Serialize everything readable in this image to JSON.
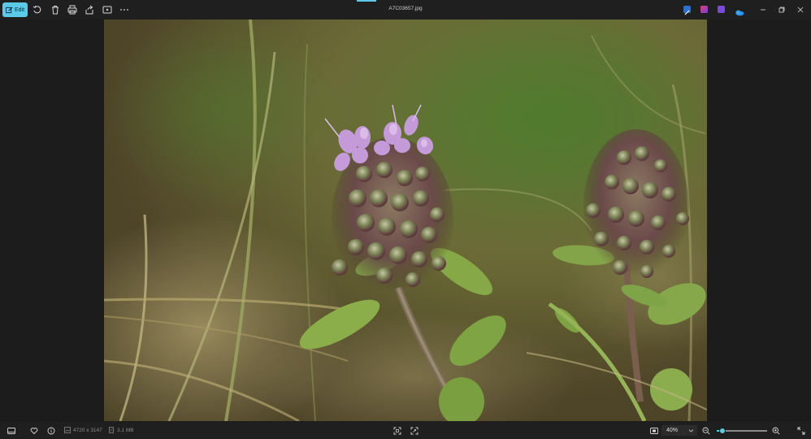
{
  "toolbar": {
    "edit_label": "Edit",
    "buttons": [
      "rotate-icon",
      "delete-icon",
      "print-icon",
      "share-icon",
      "slideshow-icon",
      "more-icon"
    ]
  },
  "window": {
    "title": "A7C03657.jpg",
    "app_icons": [
      "designer-icon",
      "clipchamp-icon",
      "clipchamp-purple-icon",
      "onedrive-icon"
    ],
    "controls": [
      "minimize-icon",
      "restore-icon",
      "close-icon"
    ]
  },
  "bottombar": {
    "dimensions": "4720 x 3147",
    "file_size": "3.1 MB",
    "zoom_level": "40%",
    "zoom_fraction": 0.12
  },
  "colors": {
    "accent": "#5cc9e8",
    "bar_bg": "#1f1f1f",
    "canvas_bg": "#1c1c1c"
  }
}
